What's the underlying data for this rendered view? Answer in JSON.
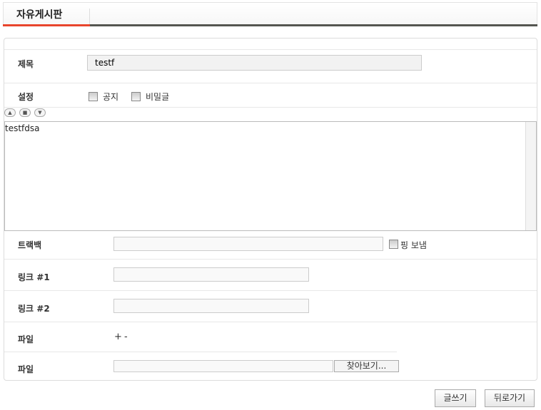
{
  "board": {
    "title": "자유게시판"
  },
  "form": {
    "subject": {
      "label": "제목",
      "value": "testf"
    },
    "settings": {
      "label": "설정",
      "notice": "공지",
      "secret": "비밀글"
    },
    "editor": {
      "content": "testfdsa",
      "buttons": [
        "▲",
        "■",
        "▼"
      ]
    },
    "trackback": {
      "label": "트랙백",
      "value": "",
      "ping": "핑 보냄"
    },
    "link1": {
      "label": "링크 #1",
      "value": ""
    },
    "link2": {
      "label": "링크 #2",
      "value": ""
    },
    "file_controls": {
      "label": "파일",
      "add": "+",
      "remove": "-"
    },
    "file": {
      "label": "파일",
      "value": "",
      "browse": "찾아보기..."
    }
  },
  "actions": {
    "write": "글쓰기",
    "back": "뒤로가기"
  }
}
